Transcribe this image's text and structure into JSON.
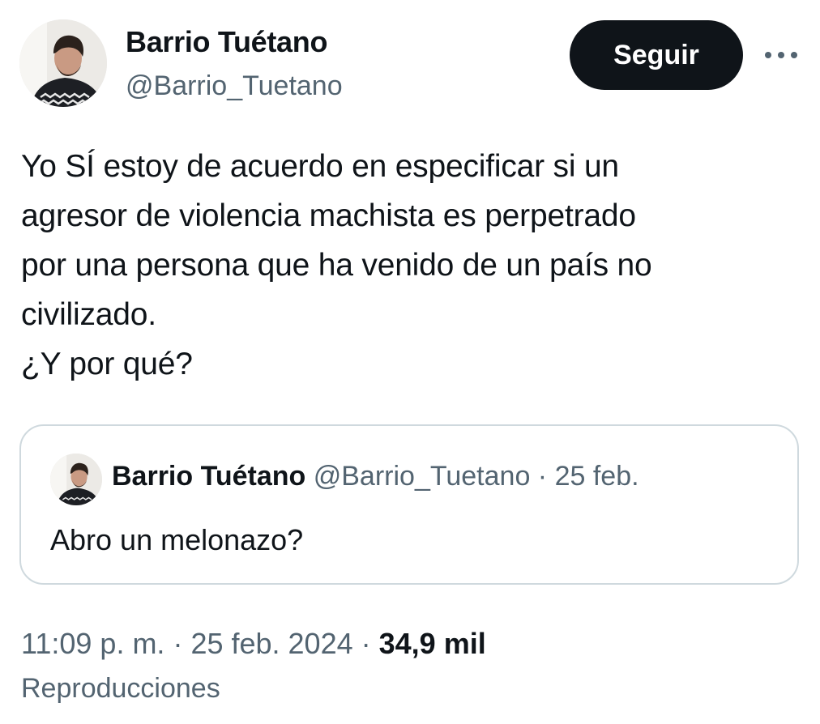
{
  "author": {
    "display_name": "Barrio Tuétano",
    "handle": "@Barrio_Tuetano"
  },
  "actions": {
    "follow_label": "Seguir",
    "more_icon": "more-horizontal-icon"
  },
  "tweet": {
    "text": "Yo SÍ estoy de acuerdo en especificar si un\nagresor de violencia machista es perpetrado\npor una persona que ha venido de un país no\ncivilizado.\n¿Y por qué?"
  },
  "quoted_tweet": {
    "display_name": "Barrio Tuétano",
    "handle": "@Barrio_Tuetano",
    "separator": " · ",
    "date": "25 feb.",
    "text": "Abro un melonazo?"
  },
  "meta": {
    "time": "11:09 p. m.",
    "separator": " · ",
    "date": "25 feb. 2024",
    "views_count": "34,9 mil",
    "views_label": "Reproducciones"
  },
  "colors": {
    "text_primary": "#0f1419",
    "text_secondary": "#536471",
    "border": "#cfd9de",
    "button_bg": "#0f1419",
    "button_text": "#ffffff"
  }
}
